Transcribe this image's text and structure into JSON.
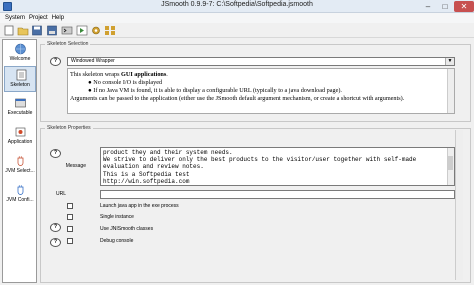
{
  "window": {
    "title": "JSmooth 0.9.9-7: C:\\Softpedia\\Softpedia.jsmooth",
    "min_glyph": "–",
    "max_glyph": "□",
    "close_glyph": "✕"
  },
  "menu": {
    "items": [
      "System",
      "Project",
      "Help"
    ]
  },
  "toolbar": {
    "buttons": [
      "new-project",
      "open-project",
      "save-project",
      "save-as-project",
      "compile",
      "run-exe",
      "options",
      "modules"
    ]
  },
  "nav": {
    "items": [
      {
        "label": "Welcome",
        "icon": "globe-icon"
      },
      {
        "label": "Skeleton",
        "icon": "skeleton-icon"
      },
      {
        "label": "Executable",
        "icon": "executable-icon"
      },
      {
        "label": "Application",
        "icon": "application-icon"
      },
      {
        "label": "JVM Select...",
        "icon": "jvm-select-icon"
      },
      {
        "label": "JVM Confi...",
        "icon": "jvm-config-icon"
      }
    ]
  },
  "skeleton_selection": {
    "legend": "Skeleton Selection",
    "selected": "Windowed Wrapper",
    "help_glyph": "?",
    "desc_line1_prefix": "This skeleton wraps ",
    "desc_line1_bold": "GUI applications",
    "desc_line1_suffix": ".",
    "bullets": [
      "No console I/O is displayed",
      "If no Java VM is found, it is able to display a configurable URL (typically to a java download page)."
    ],
    "desc_line4": "Arguments can be passed to the application (either use the JSmooth default argument mechanism, or create a shortcut with arguments)."
  },
  "skeleton_properties": {
    "legend": "Skeleton Properties",
    "message_label": "Message",
    "message_lines": [
      "product they and their system needs.",
      "We strive to deliver only the best products to the visitor/user together with self-made",
      "evaluation and review notes.",
      "This is a Softpedia test",
      "http://win.softpedia.com"
    ],
    "url_label": "URL",
    "url_value": "",
    "checkboxes": [
      {
        "label": "Launch java app in the exe process",
        "checked": false
      },
      {
        "label": "Single instance",
        "checked": false
      },
      {
        "label": "Use JNISmooth classes",
        "checked": false
      },
      {
        "label": "Debug console",
        "checked": false
      }
    ],
    "help_glyph": "?"
  },
  "colors": {
    "accent": "#3a6fbf",
    "close_red": "#c75050",
    "nav_active": "#d7e4f2"
  }
}
